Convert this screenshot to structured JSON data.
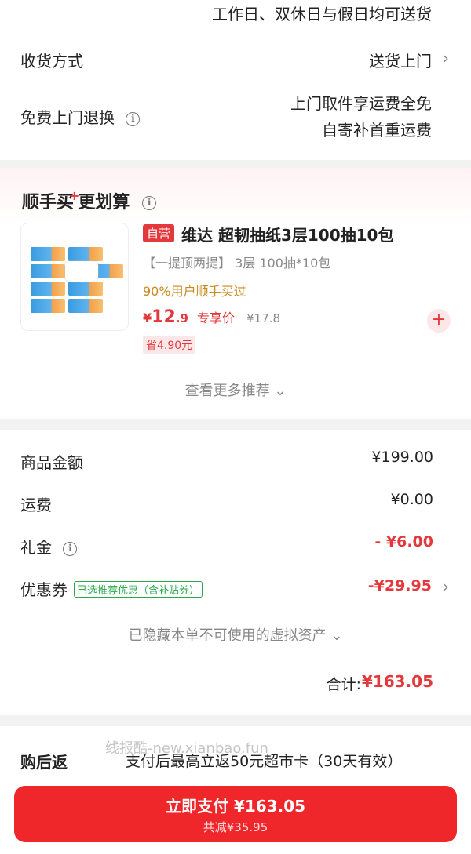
{
  "delivery": {
    "note": "工作日、双休日与假日均可送货",
    "method_label": "收货方式",
    "method_value": "送货上门",
    "return_label": "免费上门退换",
    "return_line1": "上门取件享运费全免",
    "return_line2": "自寄补首重运费"
  },
  "recommend": {
    "title_part1": "顺手买",
    "title_plus": "+",
    "title_part2": "更划算",
    "product": {
      "badge": "自营",
      "name": "维达 超韧抽纸3层100抽10包",
      "spec": "【一提顶两提】 3层 100抽*10包",
      "buyers": "90%用户顺手买过",
      "price_currency": "¥",
      "price_int": "12",
      "price_dec": ".9",
      "price_tag": "专享价",
      "orig_price": "¥17.8",
      "save": "省4.90元",
      "add_symbol": "+"
    },
    "more": "查看更多推荐 ⌄"
  },
  "totals": {
    "goods_label": "商品金额",
    "goods_value": "¥199.00",
    "shipping_label": "运费",
    "shipping_value": "¥0.00",
    "gift_label": "礼金",
    "gift_value": "- ¥6.00",
    "coupon_label": "优惠券",
    "coupon_tag": "已选推荐优惠（含补贴券）",
    "coupon_value": "-¥29.95",
    "hidden_assets": "已隐藏本单不可使用的虚拟资产 ⌄",
    "sum_label": "合计:",
    "sum_value": "¥163.05"
  },
  "cashback": {
    "label": "购后返",
    "text": "支付后最高立返50元超市卡（30天有效）",
    "watermark": "线报酷-new.xianbao.fun"
  },
  "pay": {
    "main": "立即支付 ¥163.05",
    "sub": "共减¥35.95"
  },
  "icons": {
    "chevron": "›",
    "info": "i"
  },
  "colors": {
    "accent": "#e4393c",
    "pay_button": "#f0272a",
    "coupon_green": "#2aa84a",
    "buyers_gold": "#c88a1a"
  }
}
